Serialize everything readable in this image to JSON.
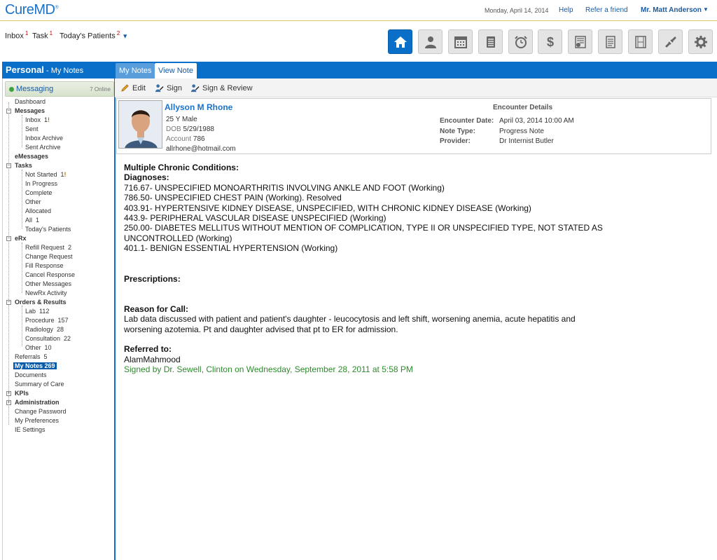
{
  "top": {
    "logo": "CureMD",
    "date": "Monday, April 14, 2014",
    "help": "Help",
    "refer": "Refer a friend",
    "user": "Mr. Matt Anderson"
  },
  "quick": {
    "inbox": "Inbox",
    "inbox_count": "1",
    "task": "Task",
    "task_count": "1",
    "patients": "Today's Patients",
    "patients_count": "2"
  },
  "toolbar_icons": [
    "home-icon",
    "patient-icon",
    "calendar-icon",
    "records-icon",
    "alarm-clock-icon",
    "dollar-icon",
    "billing-icon",
    "document-icon",
    "film-icon",
    "link-icon",
    "gear-icon"
  ],
  "left": {
    "title": "Personal",
    "subtitle": "- My Notes",
    "messaging": "Messaging",
    "online": "7 Online",
    "tree": {
      "dashboard": "Dashboard",
      "messages": "Messages",
      "inbox": "Inbox",
      "inbox_count": "1",
      "sent": "Sent",
      "inbox_archive": "Inbox Archive",
      "sent_archive": "Sent Archive",
      "emessages": "eMessages",
      "tasks": "Tasks",
      "not_started": "Not Started",
      "not_started_count": "1",
      "in_progress": "In Progress",
      "complete": "Complete",
      "other": "Other",
      "allocated": "Allocated",
      "all": "All",
      "all_count": "1",
      "todays_patients": "Today's Patients",
      "erx": "eRx",
      "refill": "Refill Request",
      "refill_count": "2",
      "change": "Change Request",
      "fill": "Fill Response",
      "cancel": "Cancel Response",
      "other_msgs": "Other Messages",
      "newrx": "NewRx Activity",
      "orders": "Orders & Results",
      "lab": "Lab",
      "lab_count": "112",
      "procedure": "Procedure",
      "procedure_count": "157",
      "radiology": "Radiology",
      "radiology_count": "28",
      "consultation": "Consultation",
      "consultation_count": "22",
      "orders_other": "Other",
      "orders_other_count": "10",
      "referrals": "Referrals",
      "referrals_count": "5",
      "my_notes": "My Notes",
      "my_notes_count": "269",
      "documents": "Documents",
      "summary": "Summary of Care",
      "kpis": "KPIs",
      "administration": "Administration",
      "change_password": "Change Password",
      "my_prefs": "My Preferences",
      "ie_settings": "IE Settings"
    }
  },
  "tabs": {
    "my_notes": "My Notes",
    "view_note": "View Note"
  },
  "actions": {
    "edit": "Edit",
    "sign": "Sign",
    "sign_review": "Sign & Review"
  },
  "patient": {
    "name": "Allyson M Rhone",
    "age_sex": "25 Y Male",
    "dob_label": "DOB",
    "dob": "5/29/1988",
    "account_label": "Account",
    "account": "786",
    "email": "allrhone@hotmail.com"
  },
  "encounter": {
    "title": "Encounter Details",
    "date_label": "Encounter Date:",
    "date": "April 03, 2014 10:00 AM",
    "type_label": "Note Type:",
    "type": "Progress Note",
    "provider_label": "Provider:",
    "provider": "Dr Internist Butler"
  },
  "note": {
    "heading": "Multiple Chronic Conditions:",
    "diag_heading": "Diagnoses:",
    "diagnoses": [
      "716.67- UNSPECIFIED MONOARTHRITIS INVOLVING ANKLE AND FOOT (Working)",
      "786.50- UNSPECIFIED CHEST PAIN (Working). Resolved",
      "403.91- HYPERTENSIVE KIDNEY DISEASE, UNSPECIFIED, WITH CHRONIC KIDNEY DISEASE (Working)",
      "443.9- PERIPHERAL VASCULAR DISEASE UNSPECIFIED (Working)",
      "250.00- DIABETES MELLITUS WITHOUT MENTION OF COMPLICATION, TYPE II OR UNSPECIFIED TYPE, NOT STATED AS UNCONTROLLED (Working)",
      "401.1- BENIGN ESSENTIAL HYPERTENSION (Working)"
    ],
    "prescriptions": "Prescriptions:",
    "reason_heading": "Reason for Call:",
    "reason": "Lab data discussed with patient and patient's daughter - leucocytosis and left shift, worsening anemia, acute hepatitis and worsening azotemia. Pt and daughter advised that pt to ER for admission.",
    "referred_heading": "Referred to:",
    "referred": "AlamMahmood",
    "signature": "Signed by Dr. Sewell, Clinton on Wednesday, September 28, 2011 at 5:58 PM"
  }
}
